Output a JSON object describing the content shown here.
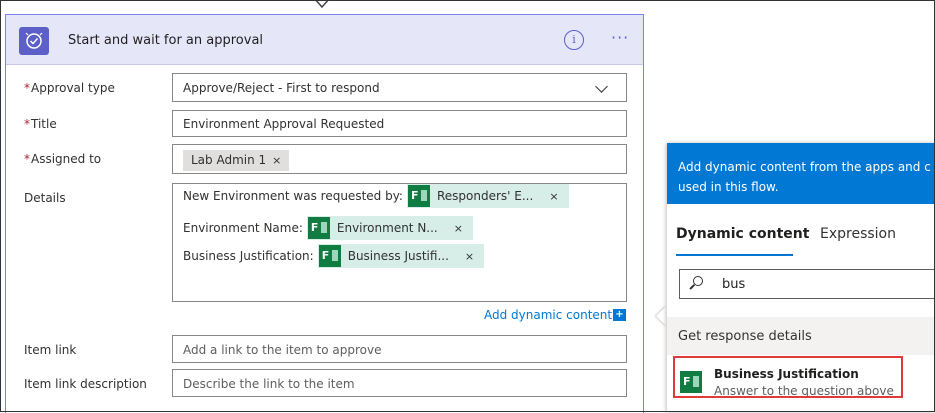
{
  "card": {
    "title": "Start and wait for an approval",
    "info_icon": "info-icon",
    "more_icon": "more-options-icon",
    "more_glyph": "···"
  },
  "form": {
    "required_mark": "*",
    "approval_type": {
      "label": "Approval type",
      "value": "Approve/Reject - First to respond"
    },
    "title": {
      "label": "Title",
      "value": "Environment Approval Requested"
    },
    "assigned_to": {
      "label": "Assigned to",
      "chip": "Lab Admin 1",
      "remove": "×"
    },
    "details": {
      "label": "Details",
      "lines": [
        {
          "text": "New Environment was requested by:",
          "token": "Responders' E...",
          "remove": "×"
        },
        {
          "text": "Environment Name:",
          "token": "Environment N...",
          "remove": "×"
        },
        {
          "text": "Business Justification:",
          "token": "Business Justifi...",
          "remove": "×"
        }
      ]
    },
    "add_dynamic_content": "Add dynamic content",
    "add_dynamic_icon": "+",
    "item_link": {
      "label": "Item link",
      "placeholder": "Add a link to the item to approve"
    },
    "item_link_description": {
      "label": "Item link description",
      "placeholder": "Describe the link to the item"
    }
  },
  "panel": {
    "header_line1": "Add dynamic content from the apps and c",
    "header_line2": "used in this flow.",
    "tabs": [
      "Dynamic content",
      "Expression"
    ],
    "search_value": "bus",
    "section": "Get response details",
    "result": {
      "name": "Business Justification",
      "description": "Answer to the question above"
    }
  },
  "forms_icon_letter": "F",
  "colors": {
    "accent": "#5b5fc7",
    "panel_blue": "#0078d4",
    "forms_green": "#107c41",
    "highlight": "#e03b3b"
  }
}
